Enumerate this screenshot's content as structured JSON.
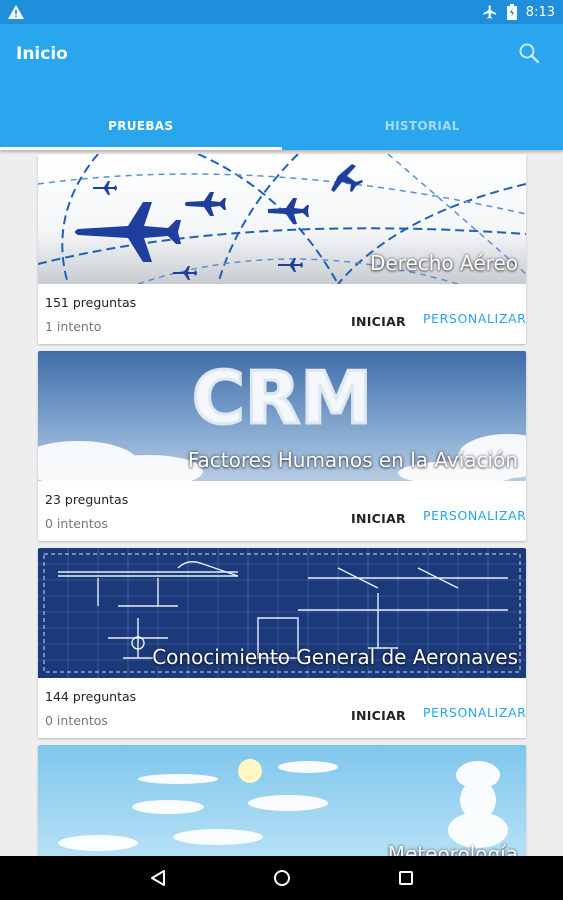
{
  "status_bar": {
    "time": "8:13",
    "warning_icon": "warning-icon",
    "airplane_icon": "airplane-mode-icon",
    "battery_icon": "battery-icon"
  },
  "app_bar": {
    "title": "Inicio",
    "search_icon": "search-icon",
    "color": "#2aa6ee"
  },
  "tabs": [
    {
      "label": "PRUEBAS",
      "active": true
    },
    {
      "label": "HISTORIAL",
      "active": false
    }
  ],
  "cards": [
    {
      "title": "Derecho Aéreo",
      "questions": "151 preguntas",
      "attempts": "1 intento",
      "start_label": "INICIAR",
      "custom_label": "PERSONALIZAR"
    },
    {
      "title": "Factores Humanos en la Aviación",
      "banner_text": "CRM",
      "questions": "23 preguntas",
      "attempts": "0 intentos",
      "start_label": "INICIAR",
      "custom_label": "PERSONALIZAR"
    },
    {
      "title": "Conocimiento General de Aeronaves",
      "questions": "144 preguntas",
      "attempts": "0 intentos",
      "start_label": "INICIAR",
      "custom_label": "PERSONALIZAR"
    },
    {
      "title": "Meteorología"
    }
  ],
  "nav_bar": {
    "back_icon": "back-icon",
    "home_icon": "home-icon",
    "recents_icon": "recents-icon"
  },
  "colors": {
    "accent": "#29a3ec",
    "status_bar": "#1f8fdc"
  }
}
